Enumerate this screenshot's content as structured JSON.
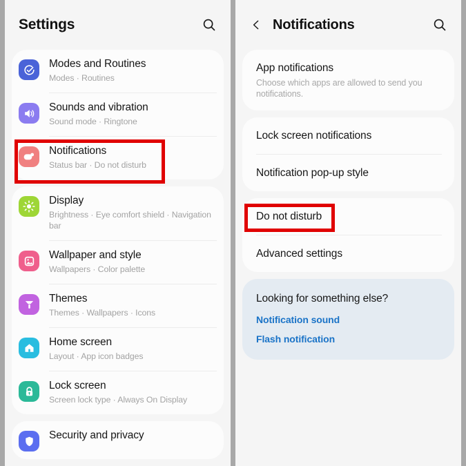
{
  "left_panel": {
    "header": {
      "title": "Settings",
      "search_icon": "search-icon"
    },
    "groups": [
      {
        "items": [
          {
            "title": "Modes and Routines",
            "subtitle": "Modes  ·  Routines",
            "icon": "modes-routines-icon",
            "icon_color": "#4a63d8"
          },
          {
            "title": "Sounds and vibration",
            "subtitle": "Sound mode  ·  Ringtone",
            "icon": "speaker-icon",
            "icon_color": "#8b7cf0"
          },
          {
            "title": "Notifications",
            "subtitle": "Status bar  ·  Do not disturb",
            "icon": "notifications-icon",
            "icon_color": "#f08080"
          }
        ]
      },
      {
        "items": [
          {
            "title": "Display",
            "subtitle": "Brightness  ·  Eye comfort shield  ·  Navigation bar",
            "icon": "brightness-icon",
            "icon_color": "#9ed636"
          },
          {
            "title": "Wallpaper and style",
            "subtitle": "Wallpapers  ·  Color palette",
            "icon": "wallpaper-icon",
            "icon_color": "#ef5f8c"
          },
          {
            "title": "Themes",
            "subtitle": "Themes  ·  Wallpapers  ·  Icons",
            "icon": "themes-icon",
            "icon_color": "#c163e0"
          },
          {
            "title": "Home screen",
            "subtitle": "Layout  ·  App icon badges",
            "icon": "home-icon",
            "icon_color": "#29bde0"
          },
          {
            "title": "Lock screen",
            "subtitle": "Screen lock type  ·  Always On Display",
            "icon": "lock-icon",
            "icon_color": "#2bb998"
          }
        ]
      },
      {
        "items": [
          {
            "title": "Security and privacy",
            "subtitle": "",
            "icon": "shield-icon",
            "icon_color": "#5b6ef0"
          }
        ]
      }
    ]
  },
  "right_panel": {
    "header": {
      "back_icon": "chevron-left-icon",
      "title": "Notifications",
      "search_icon": "search-icon"
    },
    "groups": [
      {
        "items": [
          {
            "title": "App notifications",
            "subtitle": "Choose which apps are allowed to send you notifications."
          }
        ]
      },
      {
        "items": [
          {
            "title": "Lock screen notifications",
            "subtitle": ""
          },
          {
            "title": "Notification pop-up style",
            "subtitle": ""
          }
        ]
      },
      {
        "items": [
          {
            "title": "Do not disturb",
            "subtitle": ""
          },
          {
            "title": "Advanced settings",
            "subtitle": ""
          }
        ]
      }
    ],
    "tip_card": {
      "title": "Looking for something else?",
      "links": [
        "Notification sound",
        "Flash notification"
      ]
    }
  },
  "annotations": {
    "highlight_color": "#e00000",
    "boxes": [
      {
        "target": "Notifications",
        "panel": "left"
      },
      {
        "target": "Do not disturb",
        "panel": "right"
      }
    ]
  }
}
